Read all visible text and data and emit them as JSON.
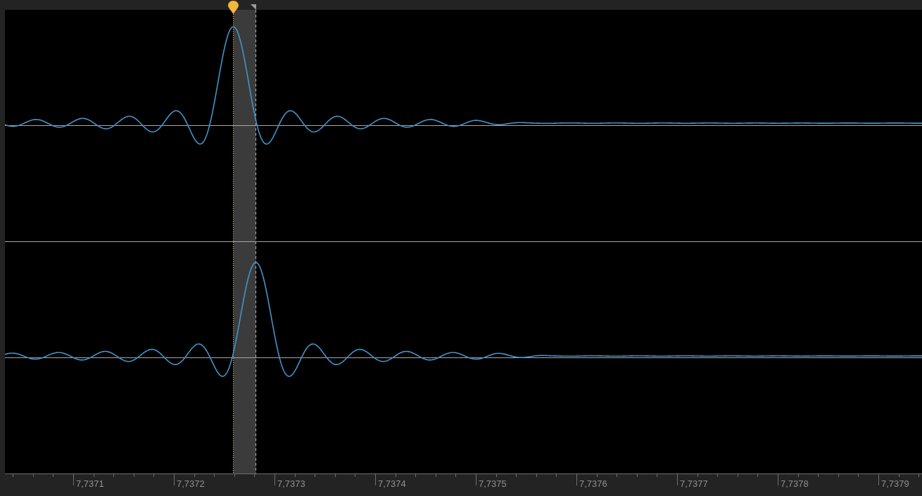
{
  "waveform_editor": {
    "time_ruler": {
      "labels": [
        "7,7371",
        "7,7372",
        "7,7373",
        "7,7374",
        "7,7375",
        "7,7376",
        "7,7377",
        "7,7378",
        "7,7379"
      ]
    }
  }
}
